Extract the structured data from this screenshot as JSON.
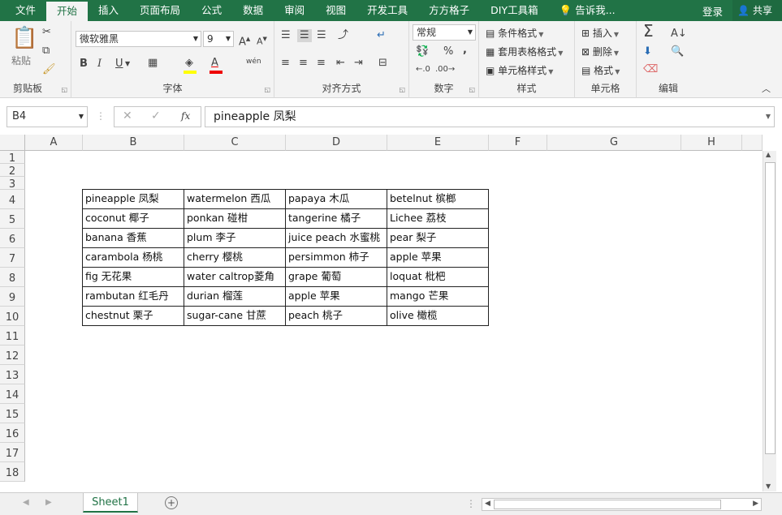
{
  "tabs": [
    "文件",
    "开始",
    "插入",
    "页面布局",
    "公式",
    "数据",
    "审阅",
    "视图",
    "开发工具",
    "方方格子",
    "DIY工具箱"
  ],
  "tell_me": "告诉我...",
  "login": "登录",
  "share": "共享",
  "ribbon": {
    "clipboard": {
      "label": "剪贴板",
      "paste": "粘贴"
    },
    "font": {
      "label": "字体",
      "name": "微软雅黑",
      "size": "9",
      "bold": "B",
      "italic": "I",
      "underline": "U",
      "font_color": "A",
      "phonetic": "wén"
    },
    "align": {
      "label": "对齐方式"
    },
    "number": {
      "label": "数字",
      "format": "常规",
      "percent": "%",
      "comma": ","
    },
    "styles": {
      "label": "样式",
      "cond": "条件格式",
      "table": "套用表格格式",
      "cell": "单元格样式"
    },
    "cells": {
      "label": "单元格",
      "insert": "插入",
      "delete": "删除",
      "format": "格式"
    },
    "edit": {
      "label": "编辑",
      "sum": "Σ"
    }
  },
  "name_box": "B4",
  "formula": "pineapple 凤梨",
  "fx": "fx",
  "columns": [
    "A",
    "B",
    "C",
    "D",
    "E",
    "F",
    "G",
    "H"
  ],
  "rows": [
    "1",
    "2",
    "3",
    "4",
    "5",
    "6",
    "7",
    "8",
    "9",
    "10",
    "11",
    "12",
    "13",
    "14",
    "15",
    "16",
    "17",
    "18"
  ],
  "table": [
    [
      "pineapple 凤梨",
      "watermelon 西瓜",
      "papaya 木瓜",
      "betelnut 槟榔"
    ],
    [
      "coconut 椰子",
      "ponkan 碰柑",
      "tangerine 橘子",
      "Lichee 荔枝"
    ],
    [
      "banana 香蕉",
      "plum 李子",
      "juice peach 水蜜桃",
      "pear 梨子"
    ],
    [
      "carambola 杨桃",
      "cherry 樱桃",
      "persimmon 柿子",
      "apple 苹果"
    ],
    [
      "fig 无花果",
      "water caltrop菱角",
      "grape 葡萄",
      "loquat 枇杷"
    ],
    [
      "rambutan 红毛丹",
      "durian 榴莲",
      "apple 苹果",
      "mango 芒果"
    ],
    [
      "chestnut 栗子",
      "sugar-cane 甘蔗",
      "peach 桃子",
      "olive 橄榄"
    ]
  ],
  "sheet_tab": "Sheet1",
  "colors": {
    "accent": "#217346"
  }
}
